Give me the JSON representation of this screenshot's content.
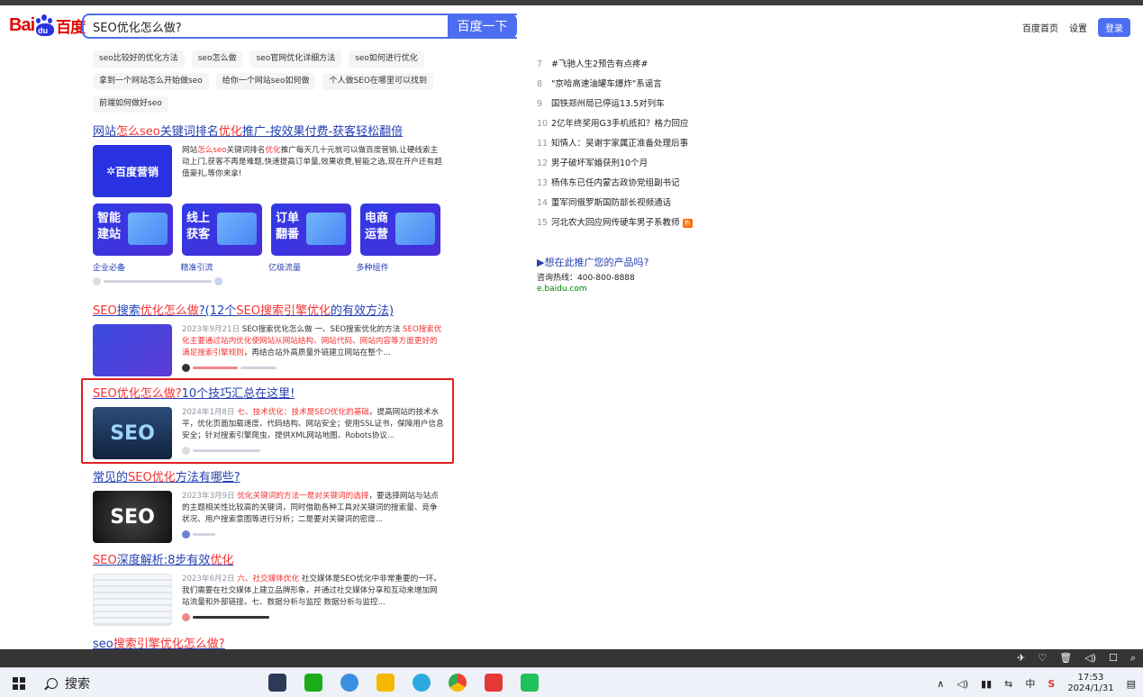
{
  "header": {
    "logo_bai": "Bai",
    "logo_du": "du",
    "logo_cn": "百度",
    "query": "SEO优化怎么做?",
    "search_button": "百度一下",
    "links": [
      "百度首页",
      "设置"
    ],
    "login": "登录"
  },
  "related": [
    "seo比较好的优化方法",
    "seo怎么做",
    "seo官网优化详细方法",
    "seo如何进行优化",
    "拿到一个网站怎么开始做seo",
    "给你一个网站seo如何做",
    "个人做SEO在哪里可以找到",
    "前端如何做好seo"
  ],
  "results": {
    "ad": {
      "title_parts": [
        "网站",
        "怎么seo",
        "关键词排名",
        "优化",
        "推广-按效果付费-获客轻松翻倍"
      ],
      "thumb_text": "百度营销",
      "desc_parts": [
        "网站",
        "怎么seo",
        "关键词排名",
        "优化",
        "推广每天几十元就可以做百度营销,让硬线索主动上门,获客不再是难题,快速提高订单量,效果收费,智能之选,现在开户还有超值豪礼,等你来拿!"
      ],
      "cards": [
        "智能建站",
        "线上获客",
        "订单翻番",
        "电商运营"
      ],
      "card_labels": [
        "企业必备",
        "精准引流",
        "亿级流量",
        "多种组件"
      ]
    },
    "r1": {
      "title_parts": [
        "SEO",
        "搜索",
        "优化怎么做",
        "?(12个",
        "SEO搜索引擎优化",
        "的有效方法)"
      ],
      "date": "2023年9月21日",
      "desc_parts": [
        " SEO搜索优化怎么做 一、SEO搜索优化的方法 ",
        "SEO搜索优化主要通过站内优化使网站从网站结构、网站代码、网站内容等方面更好的满足搜索引擎规则",
        "，再结合站外高质量外链建立网站在整个..."
      ]
    },
    "r2": {
      "title_parts": [
        "SEO优化怎么做?",
        "10个技巧汇总在这里!"
      ],
      "thumb_text": "SEO",
      "date": "2024年1月8日",
      "desc_parts": [
        " ",
        "七、技术优化：技术是SEO优化的基础",
        "，提高网站的技术水平，优化页面加载速度、代码结构、网站安全；使用SSL证书，保障用户信息安全；针对搜索引擎爬虫，提供XML网站地图、Robots协议..."
      ]
    },
    "r3": {
      "title_parts": [
        "常见的",
        "SEO优化",
        "方法有哪些?"
      ],
      "thumb_text": "SEO",
      "date": "2023年3月9日",
      "desc_parts": [
        " ",
        "优化关键词的方法一是对关键词的选择",
        "，要选择网站与站点的主题相关性比较高的关键词，同时借助各种工具对关键词的搜索量、竞争状况、用户搜索意图等进行分析；二是要对关键词的密度..."
      ]
    },
    "r4": {
      "title_parts": [
        "SEO",
        "深度解析:8步有效",
        "优化"
      ],
      "date": "2023年6月2日",
      "desc_parts": [
        " ",
        "六、社交媒体优化",
        " 社交媒体是SEO优化中非常重要的一环。我们需要在社交媒体上建立品牌形象，并通过社交媒体分享和互动来增加网站流量和外部链接。七、数据分析与监控 数据分析与监控..."
      ]
    },
    "r5": {
      "title_parts": [
        "seo",
        "搜索引擎优化怎么做?"
      ]
    }
  },
  "hot": [
    {
      "num": "7",
      "text": "#飞驰人生2预告有点疼#"
    },
    {
      "num": "8",
      "text": "\"京哈高速油罐车爆炸\"系谣言"
    },
    {
      "num": "9",
      "text": "国铁郑州局已停运13.5对列车"
    },
    {
      "num": "10",
      "text": "2亿年终奖用G3手机抵扣？格力回应"
    },
    {
      "num": "11",
      "text": "知情人：吴谢宇家属正准备处理后事"
    },
    {
      "num": "12",
      "text": "男子破坏军婚获刑10个月"
    },
    {
      "num": "13",
      "text": "杨伟东已任内蒙古政协党组副书记"
    },
    {
      "num": "14",
      "text": "董军同俄罗斯国防部长视频通话"
    },
    {
      "num": "15",
      "text": "河北农大回应网传硬车男子系教师",
      "badge": "热"
    }
  ],
  "promo": {
    "title": "▶想在此推广您的产品吗?",
    "phone": "咨询热线：400-800-8888",
    "url": "e.baidu.com"
  },
  "taskbar": {
    "search": "搜索",
    "time": "17:53",
    "date": "2024/1/31",
    "ime": "中"
  },
  "colors": {
    "accent": "#4e6ef2",
    "link": "#2440b3",
    "highlight": "#f73131",
    "brand_red": "#e10602"
  }
}
